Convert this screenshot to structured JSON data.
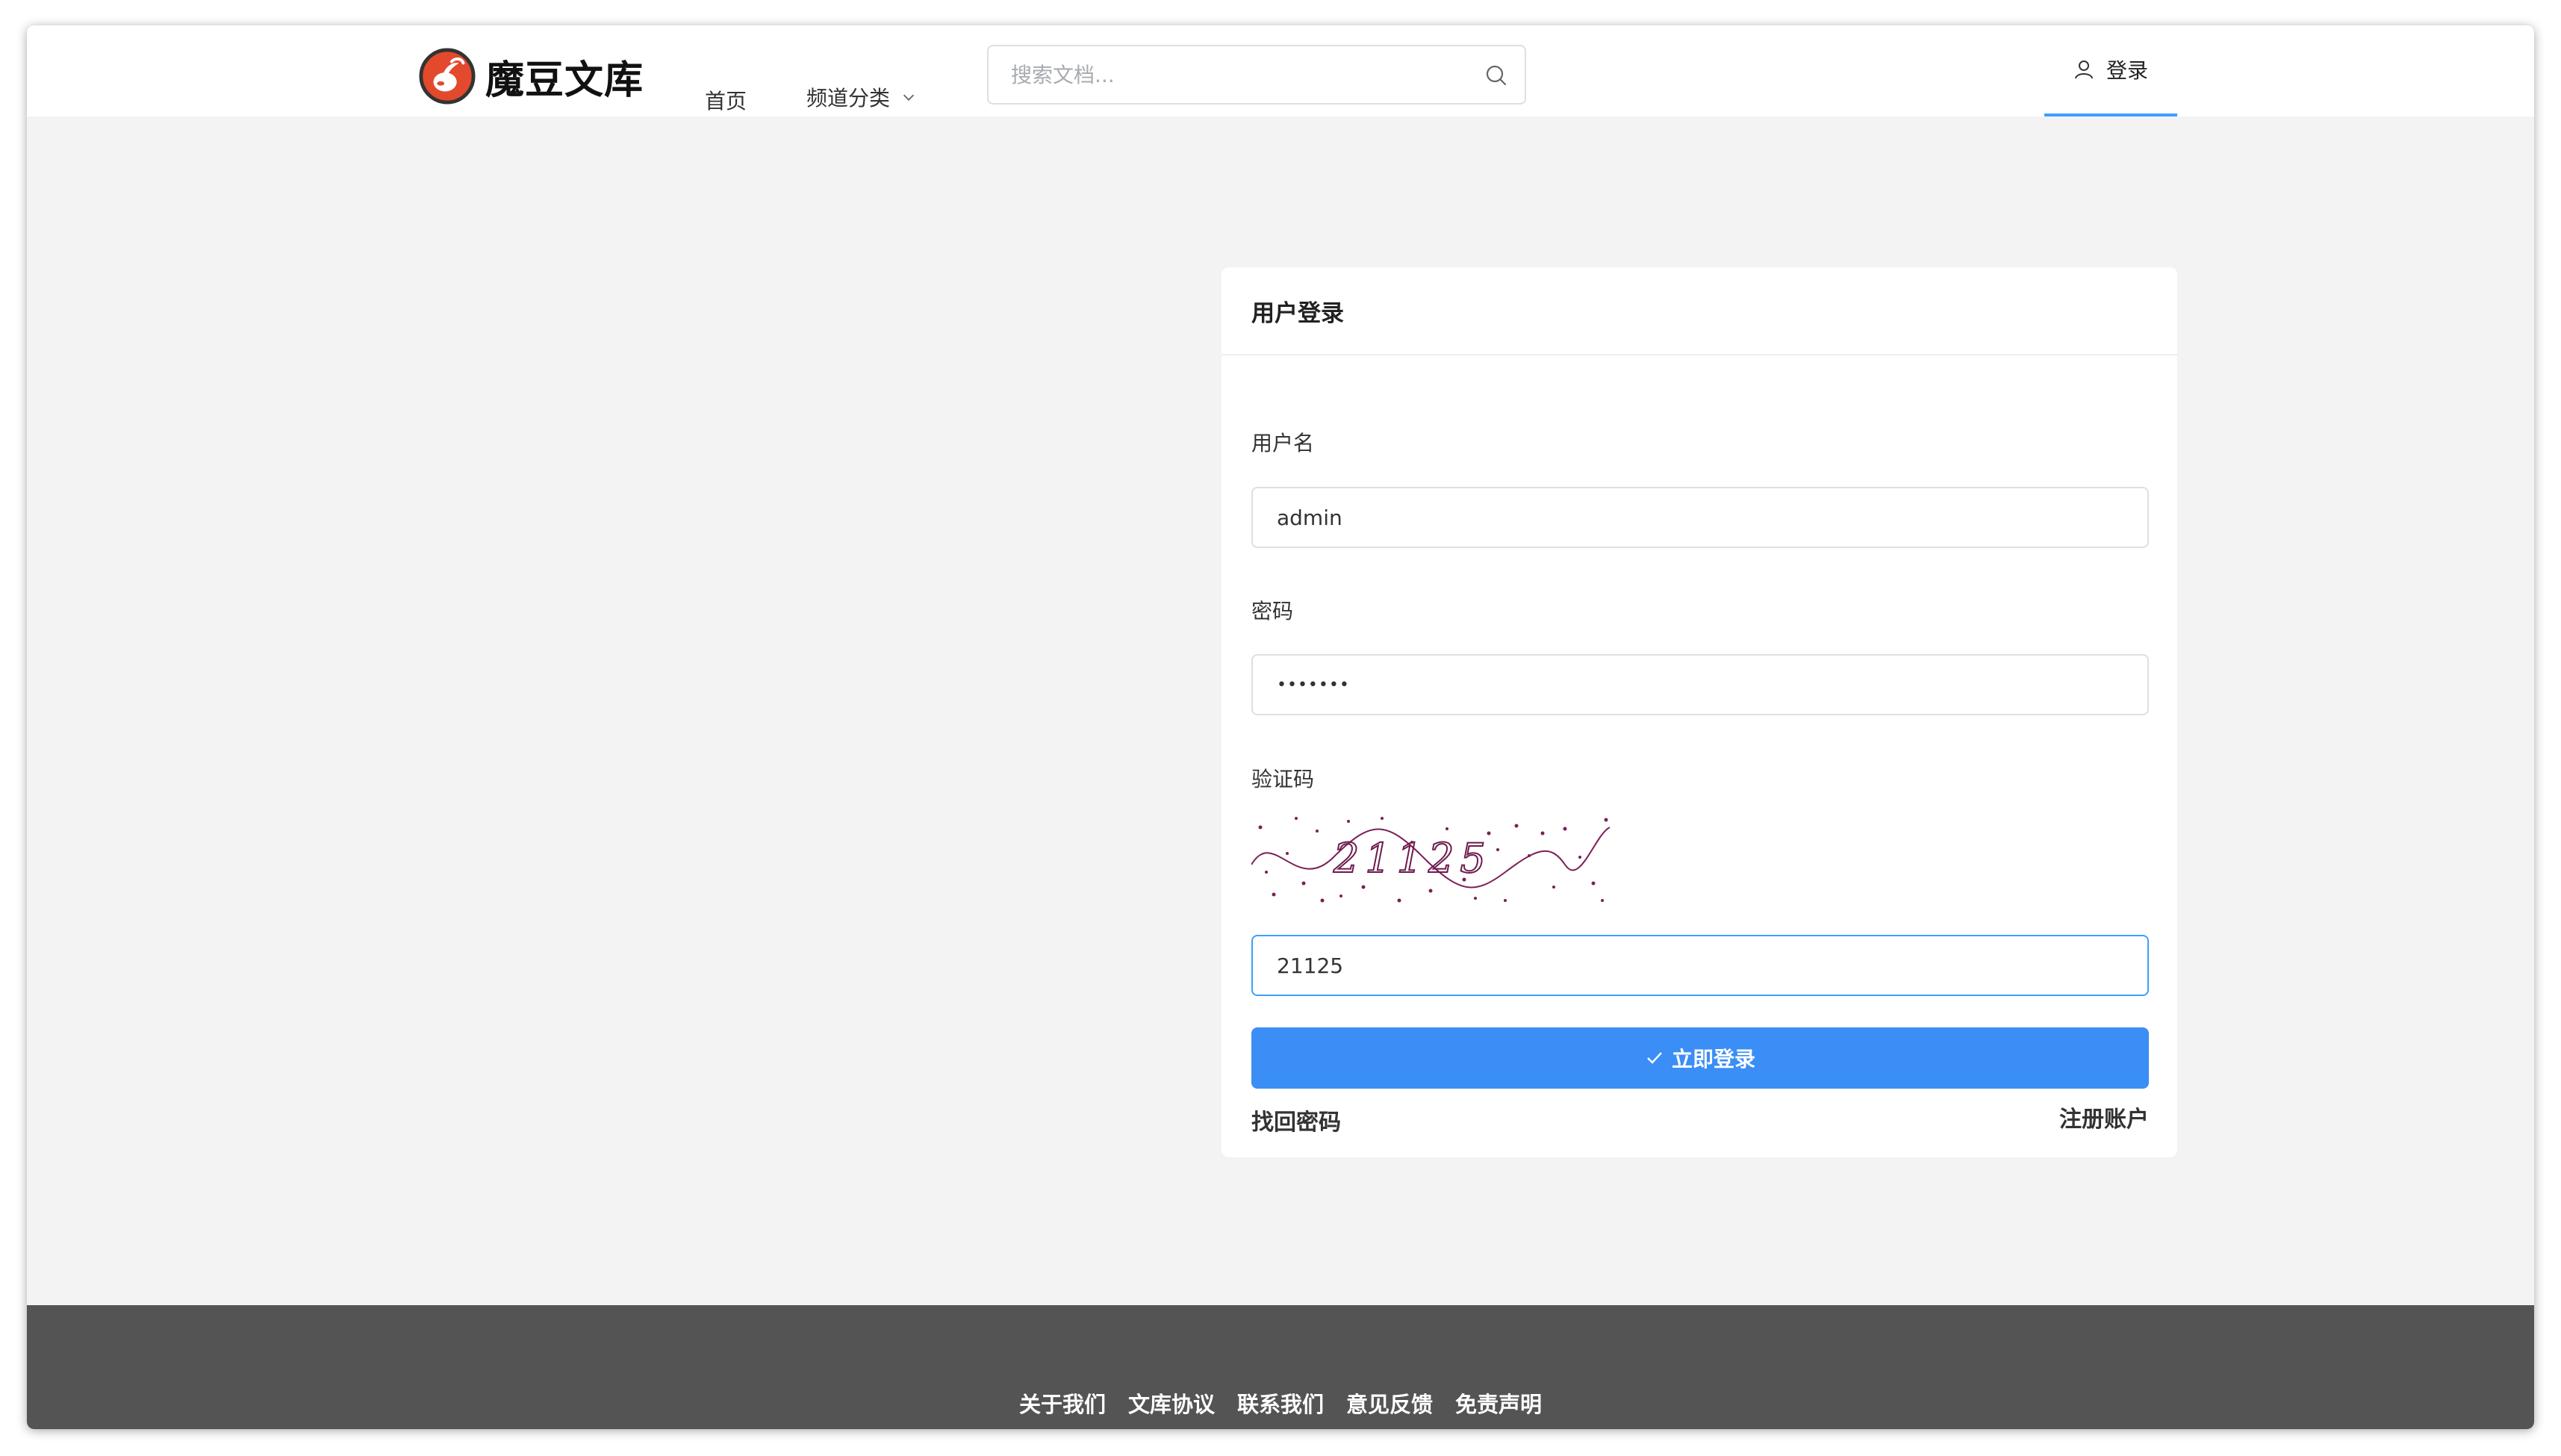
{
  "header": {
    "logo_text": "魔豆文库",
    "nav": {
      "home": "首页",
      "channel": "频道分类"
    },
    "search_placeholder": "搜索文档...",
    "login": "登录"
  },
  "login_form": {
    "title": "用户登录",
    "username_label": "用户名",
    "username_value": "admin",
    "password_label": "密码",
    "password_value": "•••••••",
    "captcha_label": "验证码",
    "captcha_image_text": "21125",
    "captcha_value": "21125",
    "submit_label": "立即登录",
    "forgot_password": "找回密码",
    "register": "注册账户"
  },
  "footer": {
    "links": [
      "关于我们",
      "文库协议",
      "联系我们",
      "意见反馈",
      "免责声明"
    ]
  },
  "colors": {
    "accent": "#409eff",
    "button": "#3a8ef6",
    "logo_red": "#e2492d",
    "footer_bg": "#545454",
    "page_bg": "#f3f3f3"
  }
}
